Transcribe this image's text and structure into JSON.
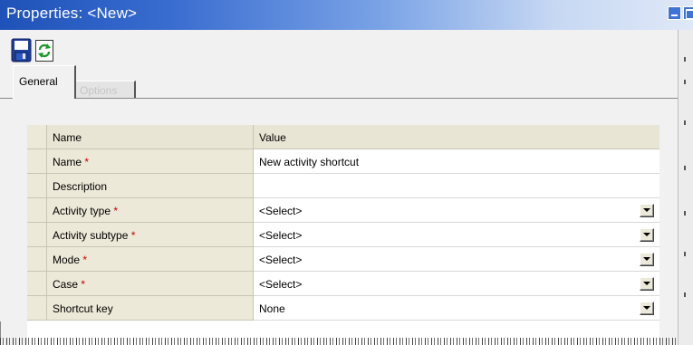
{
  "window": {
    "title": "Properties: <New>"
  },
  "toolbar": {
    "save_icon": "save-icon",
    "refresh_icon": "refresh-icon"
  },
  "tabs": [
    {
      "label": "General",
      "active": true
    },
    {
      "label": "Options",
      "active": false
    }
  ],
  "grid": {
    "header": {
      "name": "Name",
      "value": "Value"
    },
    "rows": [
      {
        "name": "Name",
        "required": true,
        "value": "New activity shortcut",
        "dropdown": false
      },
      {
        "name": "Description",
        "required": false,
        "value": "",
        "dropdown": false
      },
      {
        "name": "Activity type",
        "required": true,
        "value": "<Select>",
        "dropdown": true
      },
      {
        "name": "Activity subtype",
        "required": true,
        "value": "<Select>",
        "dropdown": true
      },
      {
        "name": "Mode",
        "required": true,
        "value": "<Select>",
        "dropdown": true
      },
      {
        "name": "Case",
        "required": true,
        "value": "<Select>",
        "dropdown": true
      },
      {
        "name": "Shortcut key",
        "required": false,
        "value": "None",
        "dropdown": true
      }
    ],
    "required_marker": "*"
  },
  "colors": {
    "title_bar_start": "#1f52b8",
    "grid_label_bg": "#ece9d8",
    "required": "#cc0000"
  }
}
